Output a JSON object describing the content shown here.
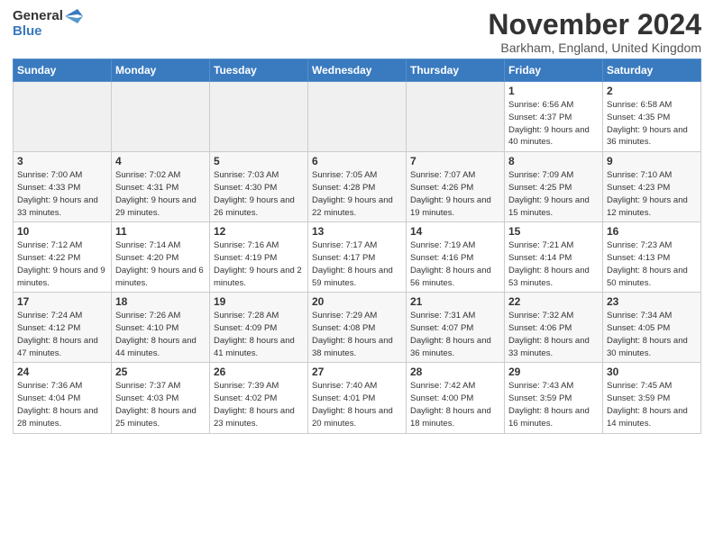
{
  "logo": {
    "general": "General",
    "blue": "Blue"
  },
  "header": {
    "month": "November 2024",
    "location": "Barkham, England, United Kingdom"
  },
  "days_of_week": [
    "Sunday",
    "Monday",
    "Tuesday",
    "Wednesday",
    "Thursday",
    "Friday",
    "Saturday"
  ],
  "weeks": [
    [
      {
        "day": "",
        "info": ""
      },
      {
        "day": "",
        "info": ""
      },
      {
        "day": "",
        "info": ""
      },
      {
        "day": "",
        "info": ""
      },
      {
        "day": "",
        "info": ""
      },
      {
        "day": "1",
        "info": "Sunrise: 6:56 AM\nSunset: 4:37 PM\nDaylight: 9 hours and 40 minutes."
      },
      {
        "day": "2",
        "info": "Sunrise: 6:58 AM\nSunset: 4:35 PM\nDaylight: 9 hours and 36 minutes."
      }
    ],
    [
      {
        "day": "3",
        "info": "Sunrise: 7:00 AM\nSunset: 4:33 PM\nDaylight: 9 hours and 33 minutes."
      },
      {
        "day": "4",
        "info": "Sunrise: 7:02 AM\nSunset: 4:31 PM\nDaylight: 9 hours and 29 minutes."
      },
      {
        "day": "5",
        "info": "Sunrise: 7:03 AM\nSunset: 4:30 PM\nDaylight: 9 hours and 26 minutes."
      },
      {
        "day": "6",
        "info": "Sunrise: 7:05 AM\nSunset: 4:28 PM\nDaylight: 9 hours and 22 minutes."
      },
      {
        "day": "7",
        "info": "Sunrise: 7:07 AM\nSunset: 4:26 PM\nDaylight: 9 hours and 19 minutes."
      },
      {
        "day": "8",
        "info": "Sunrise: 7:09 AM\nSunset: 4:25 PM\nDaylight: 9 hours and 15 minutes."
      },
      {
        "day": "9",
        "info": "Sunrise: 7:10 AM\nSunset: 4:23 PM\nDaylight: 9 hours and 12 minutes."
      }
    ],
    [
      {
        "day": "10",
        "info": "Sunrise: 7:12 AM\nSunset: 4:22 PM\nDaylight: 9 hours and 9 minutes."
      },
      {
        "day": "11",
        "info": "Sunrise: 7:14 AM\nSunset: 4:20 PM\nDaylight: 9 hours and 6 minutes."
      },
      {
        "day": "12",
        "info": "Sunrise: 7:16 AM\nSunset: 4:19 PM\nDaylight: 9 hours and 2 minutes."
      },
      {
        "day": "13",
        "info": "Sunrise: 7:17 AM\nSunset: 4:17 PM\nDaylight: 8 hours and 59 minutes."
      },
      {
        "day": "14",
        "info": "Sunrise: 7:19 AM\nSunset: 4:16 PM\nDaylight: 8 hours and 56 minutes."
      },
      {
        "day": "15",
        "info": "Sunrise: 7:21 AM\nSunset: 4:14 PM\nDaylight: 8 hours and 53 minutes."
      },
      {
        "day": "16",
        "info": "Sunrise: 7:23 AM\nSunset: 4:13 PM\nDaylight: 8 hours and 50 minutes."
      }
    ],
    [
      {
        "day": "17",
        "info": "Sunrise: 7:24 AM\nSunset: 4:12 PM\nDaylight: 8 hours and 47 minutes."
      },
      {
        "day": "18",
        "info": "Sunrise: 7:26 AM\nSunset: 4:10 PM\nDaylight: 8 hours and 44 minutes."
      },
      {
        "day": "19",
        "info": "Sunrise: 7:28 AM\nSunset: 4:09 PM\nDaylight: 8 hours and 41 minutes."
      },
      {
        "day": "20",
        "info": "Sunrise: 7:29 AM\nSunset: 4:08 PM\nDaylight: 8 hours and 38 minutes."
      },
      {
        "day": "21",
        "info": "Sunrise: 7:31 AM\nSunset: 4:07 PM\nDaylight: 8 hours and 36 minutes."
      },
      {
        "day": "22",
        "info": "Sunrise: 7:32 AM\nSunset: 4:06 PM\nDaylight: 8 hours and 33 minutes."
      },
      {
        "day": "23",
        "info": "Sunrise: 7:34 AM\nSunset: 4:05 PM\nDaylight: 8 hours and 30 minutes."
      }
    ],
    [
      {
        "day": "24",
        "info": "Sunrise: 7:36 AM\nSunset: 4:04 PM\nDaylight: 8 hours and 28 minutes."
      },
      {
        "day": "25",
        "info": "Sunrise: 7:37 AM\nSunset: 4:03 PM\nDaylight: 8 hours and 25 minutes."
      },
      {
        "day": "26",
        "info": "Sunrise: 7:39 AM\nSunset: 4:02 PM\nDaylight: 8 hours and 23 minutes."
      },
      {
        "day": "27",
        "info": "Sunrise: 7:40 AM\nSunset: 4:01 PM\nDaylight: 8 hours and 20 minutes."
      },
      {
        "day": "28",
        "info": "Sunrise: 7:42 AM\nSunset: 4:00 PM\nDaylight: 8 hours and 18 minutes."
      },
      {
        "day": "29",
        "info": "Sunrise: 7:43 AM\nSunset: 3:59 PM\nDaylight: 8 hours and 16 minutes."
      },
      {
        "day": "30",
        "info": "Sunrise: 7:45 AM\nSunset: 3:59 PM\nDaylight: 8 hours and 14 minutes."
      }
    ]
  ]
}
